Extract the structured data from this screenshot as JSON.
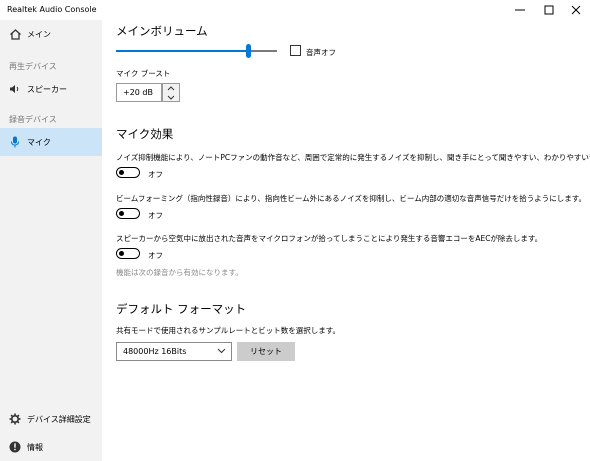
{
  "window": {
    "title": "Realtek Audio Console"
  },
  "sidebar": {
    "main_label": "メイン",
    "playback_header": "再生デバイス",
    "speaker_label": "スピーカー",
    "recording_header": "録音デバイス",
    "mic_label": "マイク",
    "device_settings_label": "デバイス詳細設定",
    "info_label": "情報"
  },
  "main_volume": {
    "title": "メインボリューム",
    "level_percent": 82,
    "mute_label": "音声オフ",
    "mute_checked": false
  },
  "mic_boost": {
    "label": "マイク ブースト",
    "value": "+20 dB"
  },
  "mic_effects": {
    "title": "マイク効果",
    "noise_suppression_desc": "ノイズ抑制機能により、ノートPCファンの動作音など、周囲で定常的に発生するノイズを抑制し、聞き手にとって聞きやすい、わかりやすい音声と",
    "noise_suppression_state": "オフ",
    "beamforming_desc": "ビームフォーミング（指向性録音）により、指向性ビーム外にあるノイズを抑制し、ビーム内部の適切な音声信号だけを拾うようにします。",
    "beamforming_state": "オフ",
    "aec_desc": "スピーカーから空気中に放出された音声をマイクロフォンが拾ってしまうことにより発生する音響エコーをAECが除去します。",
    "aec_state": "オフ",
    "note": "機能は次の録音から有効になります。"
  },
  "default_format": {
    "title": "デフォルト フォーマット",
    "description": "共有モードで使用されるサンプルレートとビット数を選択します。",
    "selected": "48000Hz 16Bits",
    "reset_label": "リセット"
  },
  "colors": {
    "accent": "#0078d7",
    "sidebar_bg": "#f2f2f2",
    "selected_bg": "#cce4f7",
    "muted_text": "#8a8a8a"
  }
}
